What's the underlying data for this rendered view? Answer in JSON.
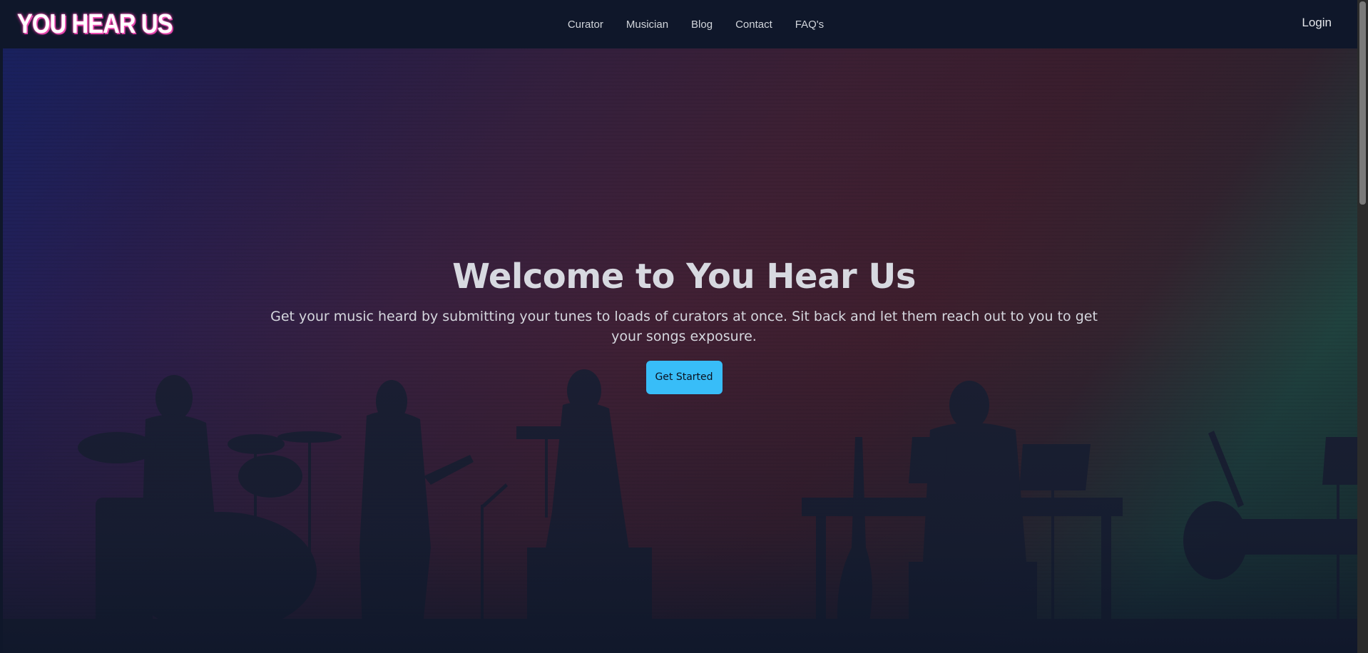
{
  "brand": {
    "logo_text": "YOU HEAR US",
    "logo_color": "#ffffff",
    "logo_glow": "#ff3fb1"
  },
  "nav": {
    "links": [
      {
        "label": "Curator"
      },
      {
        "label": "Musician"
      },
      {
        "label": "Blog"
      },
      {
        "label": "Contact"
      },
      {
        "label": "FAQ's"
      }
    ],
    "login_label": "Login"
  },
  "hero": {
    "title": "Welcome to You Hear Us",
    "subtitle": "Get your music heard by submitting your tunes to loads of curators at once. Sit back and let them reach out to you to get your songs exposure.",
    "cta_label": "Get Started",
    "cta_color": "#38bdf8",
    "background_image": "band-silhouette-on-stage"
  },
  "colors": {
    "navbar_bg": "#0f172a",
    "text_light": "#d7d9e0"
  }
}
